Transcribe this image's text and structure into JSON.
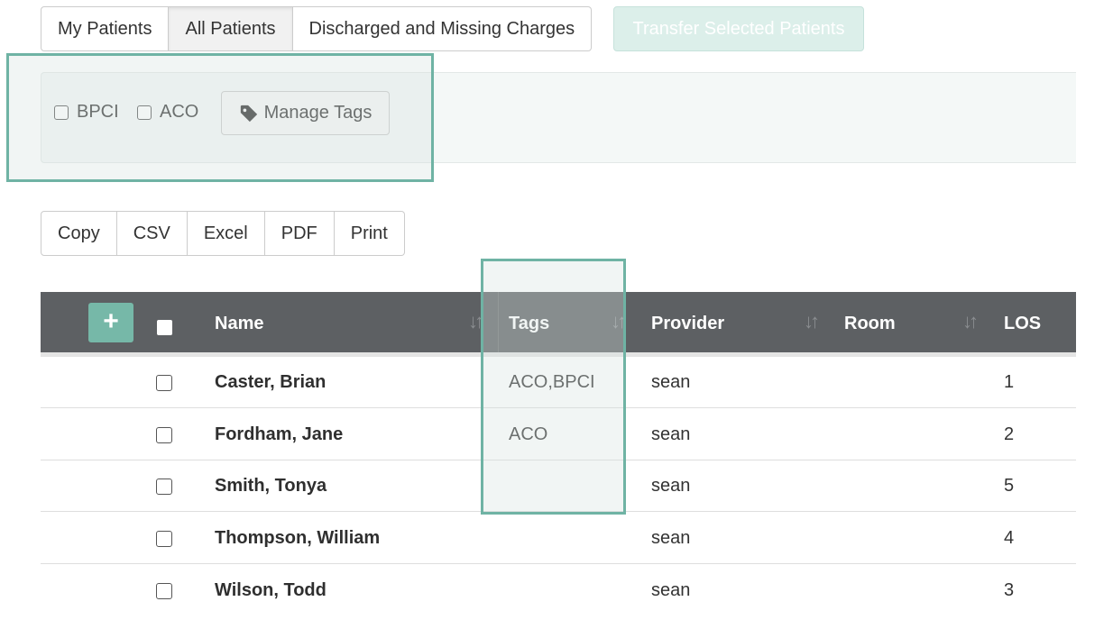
{
  "tabs": [
    {
      "label": "My Patients",
      "active": false
    },
    {
      "label": "All Patients",
      "active": true
    },
    {
      "label": "Discharged and Missing Charges",
      "active": false
    }
  ],
  "transfer_button": {
    "label": "Transfer Selected Patients",
    "disabled": true
  },
  "filters": {
    "checkboxes": [
      {
        "label": "BPCI",
        "checked": false
      },
      {
        "label": "ACO",
        "checked": false
      }
    ],
    "manage_tags_label": "Manage Tags"
  },
  "export_buttons": [
    "Copy",
    "CSV",
    "Excel",
    "PDF",
    "Print"
  ],
  "table": {
    "add_label": "+",
    "columns": [
      "Name",
      "Tags",
      "Provider",
      "Room",
      "LOS"
    ],
    "rows": [
      {
        "name": "Caster, Brian",
        "tags": "ACO,BPCI",
        "provider": "sean",
        "room": "",
        "los": "1"
      },
      {
        "name": "Fordham, Jane",
        "tags": "ACO",
        "provider": "sean",
        "room": "",
        "los": "2"
      },
      {
        "name": "Smith, Tonya",
        "tags": "",
        "provider": "sean",
        "room": "",
        "los": "5"
      },
      {
        "name": "Thompson, William",
        "tags": "",
        "provider": "sean",
        "room": "",
        "los": "4"
      },
      {
        "name": "Wilson, Todd",
        "tags": "",
        "provider": "sean",
        "room": "",
        "los": "3"
      }
    ]
  },
  "colors": {
    "accent": "#76b8a8",
    "highlight_border": "#6fb3a4",
    "header_bg": "#5d6063",
    "transfer_bg": "#dcefea"
  }
}
